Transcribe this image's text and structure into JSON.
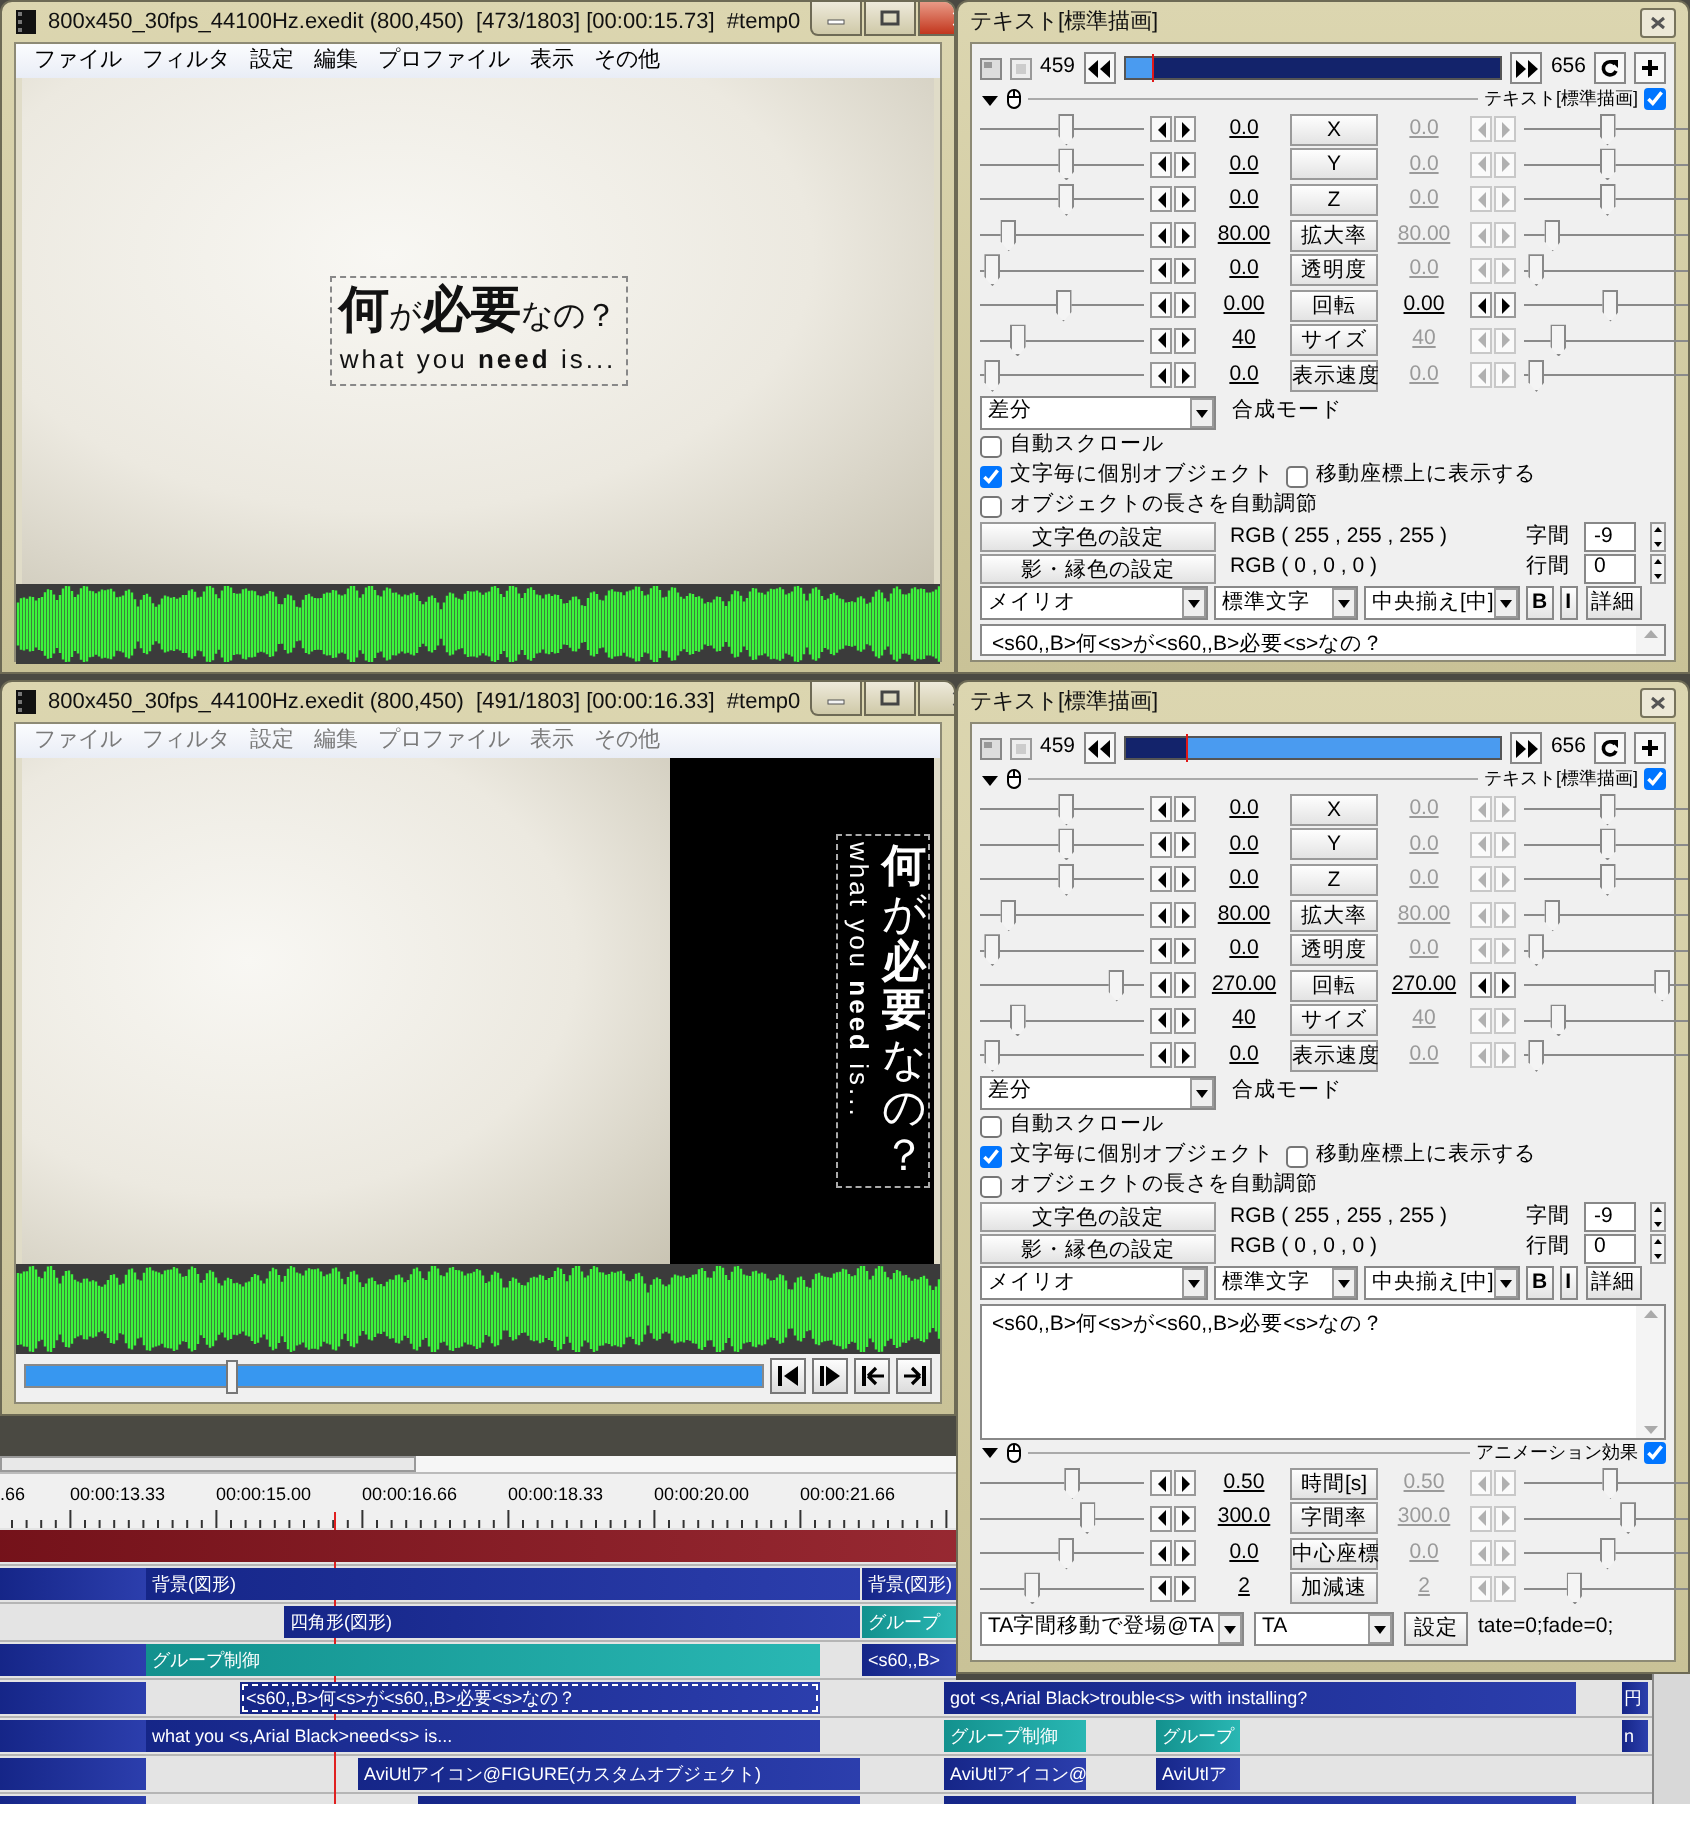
{
  "preview_windows": [
    {
      "title": "800x450_30fps_44100Hz.exedit (800,450)  [473/1803] [00:00:15.73]  #temp0",
      "active": true,
      "menu": [
        "ファイル",
        "フィルタ",
        "設定",
        "編集",
        "プロファイル",
        "表示",
        "その他"
      ],
      "preview": {
        "kind": "horizontal",
        "line_1": "**何**が**必要**なの？",
        "line_2": "what you **need** is..."
      }
    },
    {
      "title": "800x450_30fps_44100Hz.exedit (800,450)  [491/1803] [00:00:16.33]  #temp0",
      "active": false,
      "menu": [
        "ファイル",
        "フィルタ",
        "設定",
        "編集",
        "プロファイル",
        "表示",
        "その他"
      ],
      "preview": {
        "kind": "vertical",
        "line_1": "**何**が**必要**なの？",
        "line_2": "what you **need** is..."
      },
      "seek": {
        "level": 0.28
      }
    }
  ],
  "settings_panels": [
    {
      "title": "テキスト[標準描画]",
      "frame_start": "459",
      "frame_end": "656",
      "frame_bar": {
        "level": 0.07,
        "kind": "before"
      },
      "object_header": {
        "label": "テキスト[標準描画]",
        "checked": true
      },
      "params": [
        {
          "label": "X",
          "left_value": "0.0",
          "right_value": "0.0",
          "right_enabled": false,
          "left_slider": {
            "level": 0.53
          },
          "right_slider": {
            "level": 0.51
          }
        },
        {
          "label": "Y",
          "left_value": "0.0",
          "right_value": "0.0",
          "right_enabled": false,
          "left_slider": {
            "level": 0.53
          },
          "right_slider": {
            "level": 0.51
          }
        },
        {
          "label": "Z",
          "left_value": "0.0",
          "right_value": "0.0",
          "right_enabled": false,
          "left_slider": {
            "level": 0.53
          },
          "right_slider": {
            "level": 0.51
          }
        },
        {
          "label": "拡大率",
          "left_value": "80.00",
          "right_value": "80.00",
          "right_enabled": false,
          "left_slider": {
            "level": 0.14
          },
          "right_slider": {
            "level": 0.14
          }
        },
        {
          "label": "透明度",
          "left_value": "0.0",
          "right_value": "0.0",
          "right_enabled": false,
          "left_slider": {
            "level": 0.03
          },
          "right_slider": {
            "level": 0.03
          }
        },
        {
          "label": "回転",
          "left_value": "0.00",
          "right_value": "0.00",
          "right_enabled": true,
          "left_slider": {
            "level": 0.51
          },
          "right_slider": {
            "level": 0.53
          }
        },
        {
          "label": "サイズ",
          "left_value": "40",
          "right_value": "40",
          "right_enabled": false,
          "left_slider": {
            "level": 0.2
          },
          "right_slider": {
            "level": 0.18
          }
        },
        {
          "label": "表示速度",
          "left_value": "0.0",
          "right_value": "0.0",
          "right_enabled": false,
          "left_slider": {
            "level": 0.03
          },
          "right_slider": {
            "level": 0.03
          }
        }
      ],
      "blend_mode": {
        "value": "差分",
        "label": "合成モード"
      },
      "options": [
        {
          "label": "自動スクロール",
          "checked": false
        },
        {
          "label": "文字毎に個別オブジェクト",
          "checked": true
        },
        {
          "label": "移動座標上に表示する",
          "checked": false
        },
        {
          "label": "オブジェクトの長さを自動調節",
          "checked": false
        }
      ],
      "colors": [
        {
          "button": "文字色の設定",
          "value": "RGB ( 255 , 255 , 255 )",
          "spin_label": "字間",
          "spin_value": "-9"
        },
        {
          "button": "影・縁色の設定",
          "value": "RGB ( 0 , 0 , 0 )",
          "spin_label": "行間",
          "spin_value": "0"
        }
      ],
      "font": "メイリオ",
      "font_type": "標準文字",
      "align": "中央揃え[中]",
      "bold_button": "B",
      "italic_button": "I",
      "detail_button": "詳細",
      "text": "<s60,,B>何<s>が<s60,,B>必要<s>なの？"
    },
    {
      "title": "テキスト[標準描画]",
      "frame_start": "459",
      "frame_end": "656",
      "frame_bar": {
        "level": 0.16,
        "kind": "after"
      },
      "object_header": {
        "label": "テキスト[標準描画]",
        "checked": true
      },
      "params": [
        {
          "label": "X",
          "left_value": "0.0",
          "right_value": "0.0",
          "right_enabled": false,
          "left_slider": {
            "level": 0.53
          },
          "right_slider": {
            "level": 0.51
          }
        },
        {
          "label": "Y",
          "left_value": "0.0",
          "right_value": "0.0",
          "right_enabled": false,
          "left_slider": {
            "level": 0.53
          },
          "right_slider": {
            "level": 0.51
          }
        },
        {
          "label": "Z",
          "left_value": "0.0",
          "right_value": "0.0",
          "right_enabled": false,
          "left_slider": {
            "level": 0.53
          },
          "right_slider": {
            "level": 0.51
          }
        },
        {
          "label": "拡大率",
          "left_value": "80.00",
          "right_value": "80.00",
          "right_enabled": false,
          "left_slider": {
            "level": 0.14
          },
          "right_slider": {
            "level": 0.14
          }
        },
        {
          "label": "透明度",
          "left_value": "0.0",
          "right_value": "0.0",
          "right_enabled": false,
          "left_slider": {
            "level": 0.03
          },
          "right_slider": {
            "level": 0.03
          }
        },
        {
          "label": "回転",
          "left_value": "270.00",
          "right_value": "270.00",
          "right_enabled": true,
          "left_slider": {
            "level": 0.87
          },
          "right_slider": {
            "level": 0.88
          }
        },
        {
          "label": "サイズ",
          "left_value": "40",
          "right_value": "40",
          "right_enabled": false,
          "left_slider": {
            "level": 0.2
          },
          "right_slider": {
            "level": 0.18
          }
        },
        {
          "label": "表示速度",
          "left_value": "0.0",
          "right_value": "0.0",
          "right_enabled": false,
          "left_slider": {
            "level": 0.03
          },
          "right_slider": {
            "level": 0.03
          }
        }
      ],
      "blend_mode": {
        "value": "差分",
        "label": "合成モード"
      },
      "options": [
        {
          "label": "自動スクロール",
          "checked": false
        },
        {
          "label": "文字毎に個別オブジェクト",
          "checked": true
        },
        {
          "label": "移動座標上に表示する",
          "checked": false
        },
        {
          "label": "オブジェクトの長さを自動調節",
          "checked": false
        }
      ],
      "colors": [
        {
          "button": "文字色の設定",
          "value": "RGB ( 255 , 255 , 255 )",
          "spin_label": "字間",
          "spin_value": "-9"
        },
        {
          "button": "影・縁色の設定",
          "value": "RGB ( 0 , 0 , 0 )",
          "spin_label": "行間",
          "spin_value": "0"
        }
      ],
      "font": "メイリオ",
      "font_type": "標準文字",
      "align": "中央揃え[中]",
      "bold_button": "B",
      "italic_button": "I",
      "detail_button": "詳細",
      "text": "<s60,,B>何<s>が<s60,,B>必要<s>なの？",
      "animation": {
        "label": "アニメーション効果",
        "checked": true,
        "params": [
          {
            "label": "時間[s]",
            "left_value": "0.50",
            "right_value": "0.50",
            "right_enabled": false,
            "left_slider": {
              "level": 0.57
            },
            "right_slider": {
              "level": 0.53
            }
          },
          {
            "label": "字間率",
            "left_value": "300.0",
            "right_value": "300.0",
            "right_enabled": false,
            "left_slider": {
              "level": 0.67
            },
            "right_slider": {
              "level": 0.65
            }
          },
          {
            "label": "中心座標",
            "left_value": "0.0",
            "right_value": "0.0",
            "right_enabled": false,
            "left_slider": {
              "level": 0.53
            },
            "right_slider": {
              "level": 0.51
            }
          },
          {
            "label": "加減速",
            "left_value": "2",
            "right_value": "2",
            "right_enabled": false,
            "left_slider": {
              "level": 0.3
            },
            "right_slider": {
              "level": 0.29
            }
          }
        ],
        "effect": "TA字間移動で登場@TA",
        "script": "TA",
        "settings_button": "設定",
        "settings_value": "tate=0;fade=0;"
      }
    }
  ],
  "timeline": {
    "ruler_labels": [
      ".66",
      "00:00:13.33",
      "00:00:15.00",
      "00:00:16.66",
      "00:00:18.33",
      "00:00:20.00",
      "00:00:21.66"
    ],
    "layers": [
      {
        "clips": [
          {
            "color": "#8e1620",
            "selected": false
          }
        ]
      },
      {
        "clips": [
          {
            "color": "#1a2ea6",
            "selected": false
          },
          {
            "text": "背景(図形)",
            "color": "#1a2ea6",
            "selected": false
          },
          {
            "text": "背景(図形)",
            "color": "#1a2ea6",
            "selected": false
          }
        ]
      },
      {
        "clips": [
          {
            "text": "四角形(図形)",
            "color": "#1a2ea6",
            "selected": false
          },
          {
            "text": "グループ",
            "color": "#17b1ad",
            "selected": false
          }
        ]
      },
      {
        "clips": [
          {
            "color": "#1a2ea6",
            "selected": false
          },
          {
            "text": "グループ制御",
            "color": "#17b1ad",
            "selected": false
          },
          {
            "text": "<s60,,B>",
            "color": "#1a2ea6",
            "selected": false
          }
        ]
      },
      {
        "clips": [
          {
            "color": "#1a2ea6",
            "selected": false
          },
          {
            "text": "<s60,,B>何<s>が<s60,,B>必要<s>なの？",
            "color": "#1a2ea6",
            "selected": true
          },
          {
            "text": "got <s,Arial Black>trouble<s> with installing?",
            "color": "#1a2ea6",
            "selected": false
          },
          {
            "text": "円",
            "color": "#1a2ea6",
            "selected": false
          }
        ]
      },
      {
        "clips": [
          {
            "color": "#1a2ea6",
            "selected": false
          },
          {
            "text": "what you <s,Arial Black>need<s> is...",
            "color": "#1a2ea6",
            "selected": false
          },
          {
            "text": "グループ制御",
            "color": "#17b1ad",
            "selected": false
          },
          {
            "text": "グループ",
            "color": "#17b1ad",
            "selected": false
          },
          {
            "text": "n",
            "color": "#1a2ea6",
            "selected": false
          }
        ]
      },
      {
        "clips": [
          {
            "color": "#1a2ea6",
            "selected": false
          },
          {
            "text": "AviUtlアイコン@FIGURE(カスタムオブジェクト)",
            "color": "#1a2ea6",
            "selected": false
          },
          {
            "text": "AviUtlアイコン@",
            "color": "#1a2ea6",
            "selected": false
          },
          {
            "text": "AviUtlア",
            "color": "#1a2ea6",
            "selected": false
          }
        ]
      },
      {
        "clips": [
          {
            "color": "#1a2ea6",
            "selected": false
          },
          {
            "color": "#1a2ea6",
            "selected": false
          },
          {
            "color": "#1a2ea6",
            "selected": false
          }
        ]
      }
    ]
  }
}
